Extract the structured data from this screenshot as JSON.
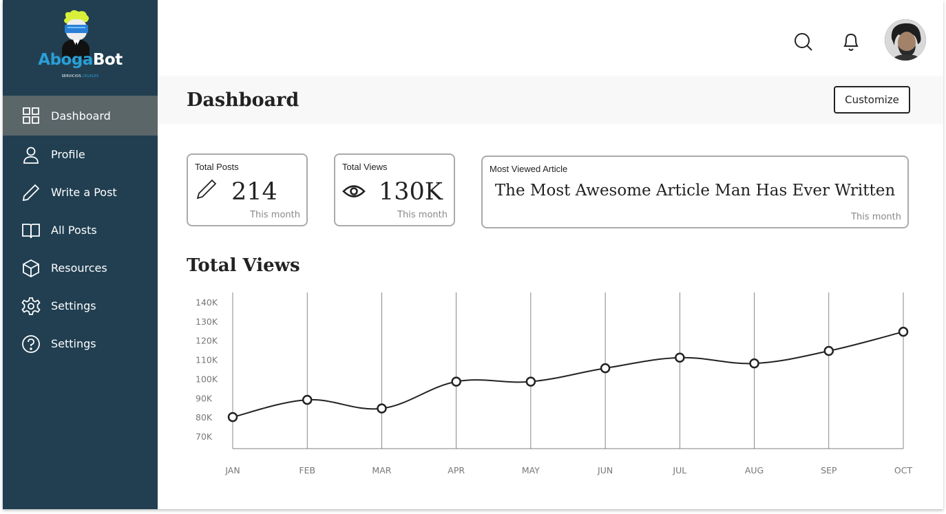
{
  "brand": {
    "name_part1": "Aboga",
    "name_part2": "Bot",
    "tagline_part1": "SERVICIOS ",
    "tagline_part2": "LEGALES",
    "accent_color": "#2a9fd6"
  },
  "sidebar": {
    "background": "#213f51",
    "items": [
      {
        "label": "Dashboard",
        "icon": "grid-icon",
        "active": true
      },
      {
        "label": "Profile",
        "icon": "user-icon",
        "active": false
      },
      {
        "label": "Write a Post",
        "icon": "pencil-icon",
        "active": false
      },
      {
        "label": "All Posts",
        "icon": "book-icon",
        "active": false
      },
      {
        "label": "Resources",
        "icon": "cube-icon",
        "active": false
      },
      {
        "label": "Settings",
        "icon": "gear-icon",
        "active": false
      },
      {
        "label": "Settings",
        "icon": "help-circle-icon",
        "active": false
      }
    ]
  },
  "header": {
    "search_icon": "search-icon",
    "notification_icon": "bell-icon",
    "avatar_icon": "avatar"
  },
  "page": {
    "title": "Dashboard",
    "customize_label": "Customize"
  },
  "stats": {
    "total_posts": {
      "label": "Total Posts",
      "value": "214",
      "note": "This month",
      "icon": "pencil-icon"
    },
    "total_views": {
      "label": "Total Views",
      "value": "130K",
      "note": "This month",
      "icon": "eye-icon"
    },
    "most_viewed": {
      "label": "Most Viewed Article",
      "value": "The Most Awesome Article Man Has Ever Written",
      "note": "This month"
    }
  },
  "chart_section": {
    "title": "Total Views"
  },
  "chart_data": {
    "type": "line",
    "categories": [
      "JAN",
      "FEB",
      "MAR",
      "APR",
      "MAY",
      "JUN",
      "JUL",
      "AUG",
      "SEP",
      "OCT"
    ],
    "values": [
      80000,
      89000,
      84500,
      98500,
      98500,
      105500,
      111000,
      108000,
      114500,
      124500
    ],
    "y_ticks": [
      "140K",
      "130K",
      "120K",
      "110K",
      "100K",
      "90K",
      "80K",
      "70K"
    ],
    "ylim": [
      66000,
      142000
    ],
    "grid": "vertical",
    "line_color": "#222222"
  }
}
